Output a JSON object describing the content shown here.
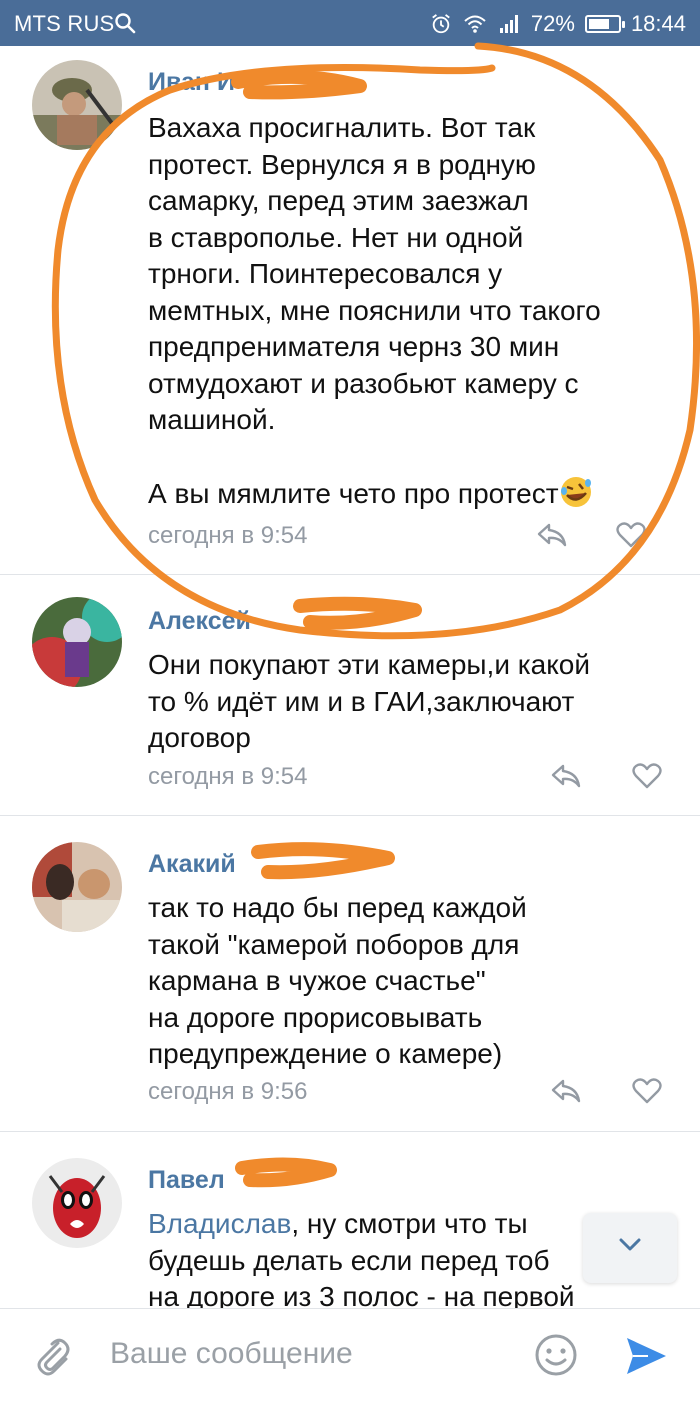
{
  "status_bar": {
    "carrier": "MTS RUS",
    "battery": "72%",
    "battery_level": 0.72,
    "time": "18:44",
    "icons": [
      "search-icon",
      "alarm-icon",
      "wifi-icon",
      "signal-icon",
      "battery-icon"
    ]
  },
  "comments": [
    {
      "author": "Иван И",
      "text": "Вахаха просигналить. Вот так\nпротест. Вернулся я в родную\nсамарку, перед этим заезжал\nв ставрополье. Нет ни одной\nтрноги. Поинтересовался у\nмемтных, мне пояснили что такого\nпредпренимателя чернз 30 мин\nотмудохают и разобьют камеру с\nмашиной.\n\nА вы мямлите чето про протест",
      "emoji": "rolling-laughing-emoji",
      "time": "сегодня в 9:54"
    },
    {
      "author": "Алексей",
      "text": "Они покупают эти камеры,и какой\nто % идёт им и в ГАИ,заключают\nдоговор",
      "time": "сегодня в 9:54"
    },
    {
      "author": "Акакий",
      "text": "так то надо бы перед каждой\nтакой \"камерой поборов для\nкармана в чужое счастье\"\nна дороге прорисовывать\nпредупреждение о камере)",
      "time": "сегодня в 9:56"
    },
    {
      "author": "Павел",
      "mention": "Владислав",
      "text": ", ну смотри что ты\nбудешь делать если перед тоб\nна дороге из 3 полос - на первой"
    }
  ],
  "composer": {
    "placeholder": "Ваше сообщение"
  },
  "colors": {
    "status_bar": "#4a6d98",
    "author": "#4b77a3",
    "meta": "#939aa3",
    "send": "#3d8ce6",
    "scribble": "#f08a2c"
  }
}
